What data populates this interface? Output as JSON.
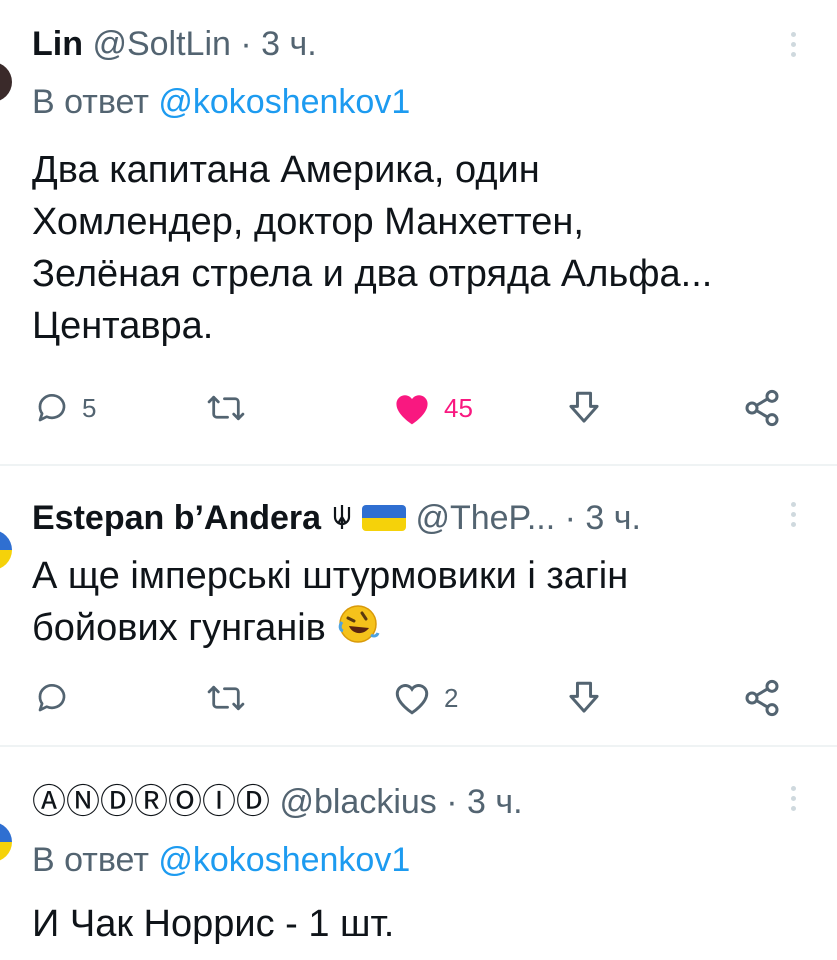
{
  "tweets": [
    {
      "name": "Lin",
      "handle": "@SoltLin",
      "separator": "·",
      "time": "3 ч.",
      "reply_prefix": "В ответ",
      "reply_mention": "@kokoshenkov1",
      "body_lines": [
        "Два капитана Америка, один",
        "Хомлендер, доктор Манхеттен,",
        "Зелёная стрела и два отряда Альфа...",
        "Центавра."
      ],
      "actions": {
        "reply_count": "5",
        "retweet_count": "",
        "like_count": "45",
        "liked": true
      }
    },
    {
      "name": "Estepan b’Andera",
      "handle": "@TheP...",
      "separator": "·",
      "time": "3 ч.",
      "body_lines": [
        "А ще імперські штурмовики і загін",
        "бойових гунганів"
      ],
      "actions": {
        "reply_count": "",
        "retweet_count": "",
        "like_count": "2",
        "liked": false
      }
    },
    {
      "name": "ⒶⓃⒹⓇⓄⒾⒹ",
      "handle": "@blackius",
      "separator": "·",
      "time": "3 ч.",
      "reply_prefix": "В ответ",
      "reply_mention": "@kokoshenkov1",
      "body_lines": [
        "И Чак Норрис - 1 шт."
      ]
    }
  ],
  "icons": {
    "reply": "speech-bubble-icon",
    "retweet": "retweet-icon",
    "like": "heart-icon",
    "share": "share-icon",
    "more": "more-vertical-icon"
  },
  "colors": {
    "like_active": "#f91880",
    "mention": "#1d9bf0",
    "secondary_text": "#536471"
  }
}
